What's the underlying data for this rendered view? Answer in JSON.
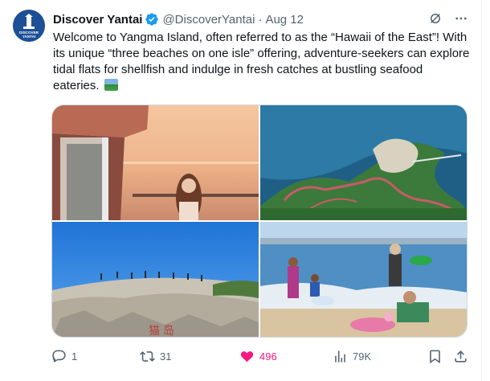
{
  "tweet": {
    "author_name": "Discover Yantai",
    "handle": "@DiscoverYantai",
    "separator": "·",
    "date": "Aug 12",
    "avatar_text": "DISCOVER YANTAI",
    "text": "Welcome to Yangma Island, often referred to as the “Hawaii of the East”! With its unique “three beaches on one isle” offering, adventure-seekers can explore tidal flats for shellfish and indulge in fresh catches at bustling seafood eateries.",
    "media": [
      {
        "name": "photo-woman-sunset"
      },
      {
        "name": "photo-aerial-island"
      },
      {
        "name": "photo-rocky-hilltop"
      },
      {
        "name": "photo-beach-children"
      }
    ]
  },
  "actions": {
    "replies": "1",
    "reposts": "31",
    "likes": "496",
    "views": "79K"
  },
  "colors": {
    "like": "#f91880",
    "verified": "#1d9bf0",
    "secondary_text": "#536471"
  },
  "icons": [
    "grok-icon",
    "more-icon",
    "verified-badge-icon",
    "reply-icon",
    "repost-icon",
    "like-icon",
    "views-icon",
    "bookmark-icon",
    "share-icon"
  ]
}
